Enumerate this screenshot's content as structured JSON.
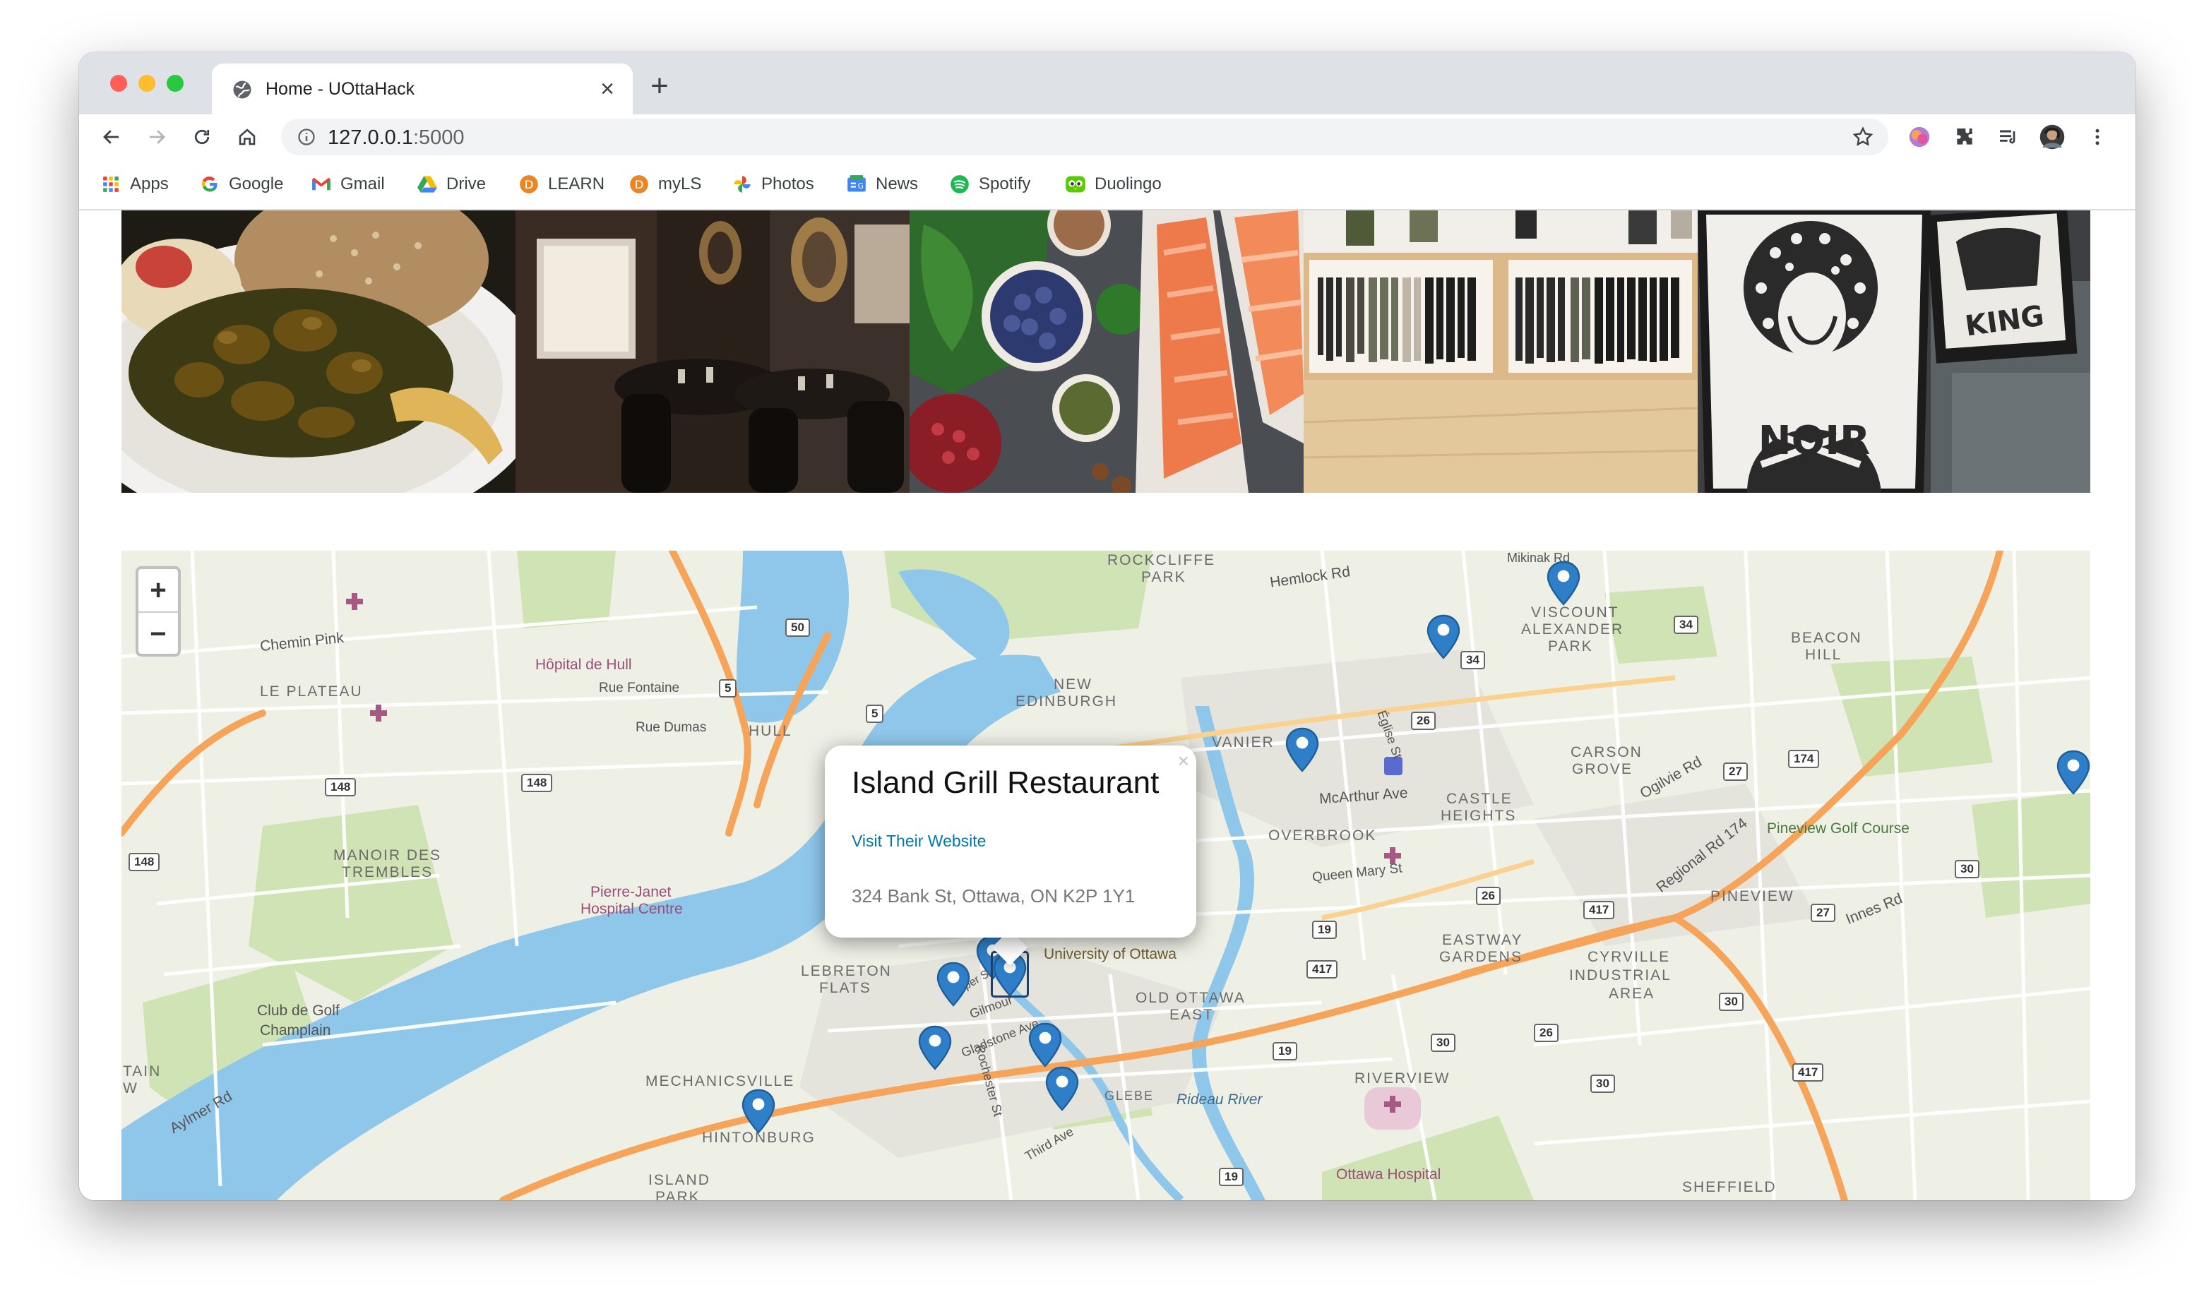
{
  "browser": {
    "tab_title": "Home - UOttaHack",
    "url_host": "127.0.0.1",
    "url_port": ":5000",
    "bookmarks": [
      {
        "label": "Apps",
        "icon": "apps-grid-icon"
      },
      {
        "label": "Google",
        "icon": "google-icon"
      },
      {
        "label": "Gmail",
        "icon": "gmail-icon"
      },
      {
        "label": "Drive",
        "icon": "drive-icon"
      },
      {
        "label": "LEARN",
        "icon": "learn-icon"
      },
      {
        "label": "myLS",
        "icon": "myls-icon"
      },
      {
        "label": "Photos",
        "icon": "photos-icon"
      },
      {
        "label": "News",
        "icon": "news-icon"
      },
      {
        "label": "Spotify",
        "icon": "spotify-icon"
      },
      {
        "label": "Duolingo",
        "icon": "duolingo-icon"
      }
    ]
  },
  "map": {
    "zoom_in": "+",
    "zoom_out": "−",
    "popup": {
      "title": "Island Grill Restaurant",
      "link": "Visit Their Website",
      "address": "324 Bank St, Ottawa, ON K2P 1Y1",
      "close": "×"
    },
    "labels": {
      "rockcliffe": "ROCKCLIFFE",
      "park": "PARK",
      "hemlock": "Hemlock Rd",
      "mikinak": "Mikinak Rd",
      "viscount": "VISCOUNT",
      "alexander": "ALEXANDER",
      "park2": "PARK",
      "beacon": "BEACON",
      "hill": "HILL",
      "chemin_pink": "Chemin Pink",
      "hopital_hull": "Hôpital de Hull",
      "rue_fontaine": "Rue Fontaine",
      "le_plateau": "LE PLATEAU",
      "rue_dumas": "Rue Dumas",
      "hull": "HULL",
      "new_edinburgh": "NEW",
      "edinburgh": "EDINBURGH",
      "vanier": "VANIER",
      "eglise": "Église St",
      "carson": "CARSON",
      "grove": "GROVE",
      "ogilvie": "Ogilvie Rd",
      "mcarthur": "McArthur Ave",
      "castle": "CASTLE",
      "heights": "HEIGHTS",
      "pineview_golf": "Pineview Golf Course",
      "manoir": "MANOIR DES",
      "trembles": "TREMBLES",
      "overbrook": "OVERBROOK",
      "queen_mary": "Queen Mary St",
      "regional": "Regional Rd 174",
      "pierre_janet": "Pierre-Janet",
      "hospital_centre": "Hospital Centre",
      "pineview": "PINEVIEW",
      "innes": "Innes Rd",
      "eastway": "EASTWAY",
      "gardens": "GARDENS",
      "cyrville": "CYRVILLE",
      "industrial": "INDUSTRIAL",
      "area": "AREA",
      "lebreton": "LEBRETON",
      "flats": "FLATS",
      "uottawa": "University of Ottawa",
      "old_ottawa": "OLD OTTAWA",
      "east": "EAST",
      "golf": "Club de Golf",
      "champlain": "Champlain",
      "gilmour": "Gilmour",
      "gladstone": "Gladstone Ave",
      "mechanicsville": "MECHANICSVILLE",
      "rochester": "Rochester St",
      "riverview": "RIVERVIEW",
      "rideau": "Rideau River",
      "aylmer": "Aylmer Rd",
      "hintonburg": "HINTONBURG",
      "third": "Third Ave",
      "ottawa_hospital": "Ottawa Hospital",
      "island": "ISLAND",
      "park3": "PARK",
      "sheffield": "SHEFFIELD",
      "tain": "TAIN",
      "w": "W",
      "glebe": "GLEBE",
      "cooper": "Cooper St"
    },
    "shields": [
      "50",
      "5",
      "5",
      "148",
      "148",
      "148",
      "34",
      "34",
      "26",
      "27",
      "174",
      "26",
      "19",
      "417",
      "417",
      "27",
      "30",
      "30",
      "19",
      "30",
      "26",
      "30",
      "417",
      "19"
    ]
  }
}
